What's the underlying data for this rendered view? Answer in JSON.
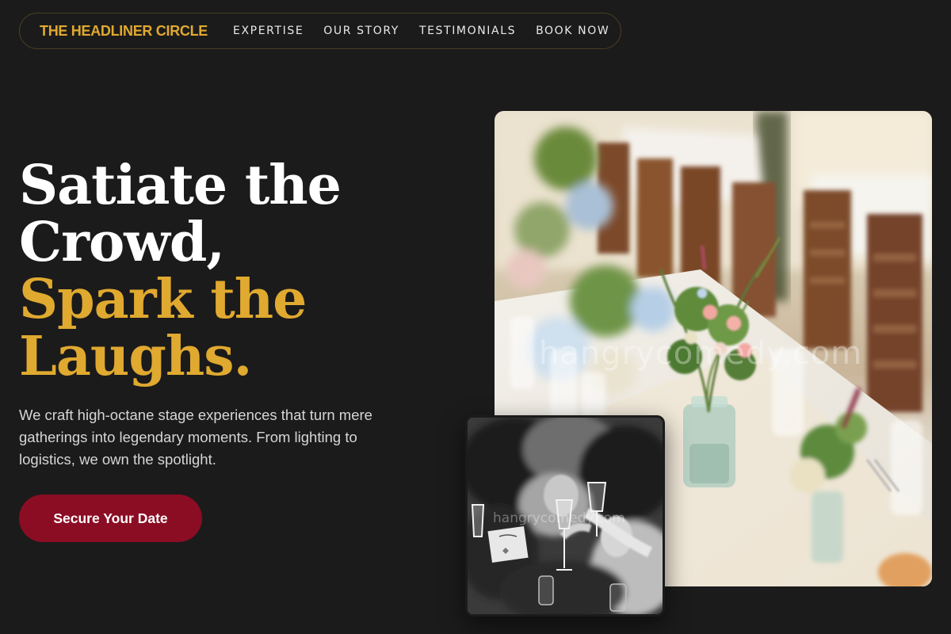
{
  "nav": {
    "brand": "THE HEADLINER CIRCLE",
    "links": [
      "EXPERTISE",
      "OUR STORY",
      "TESTIMONIALS",
      "BOOK NOW"
    ]
  },
  "hero": {
    "headline_white_1": "Satiate the",
    "headline_white_2": "Crowd,",
    "headline_gold_1": "Spark the",
    "headline_gold_2": "Laughs.",
    "lead": "We craft high-octane stage experiences that turn mere gatherings into legendary moments. From lighting to logistics, we own the spotlight.",
    "cta_label": "Secure Your Date"
  },
  "images": {
    "main_watermark": "hangrycomedy.com",
    "sub_watermark": "hangrycomedy.com"
  },
  "colors": {
    "background": "#1b1b1b",
    "accent_gold": "#e0a92f",
    "cta": "#8b0d24",
    "nav_border": "#4a3d24"
  }
}
